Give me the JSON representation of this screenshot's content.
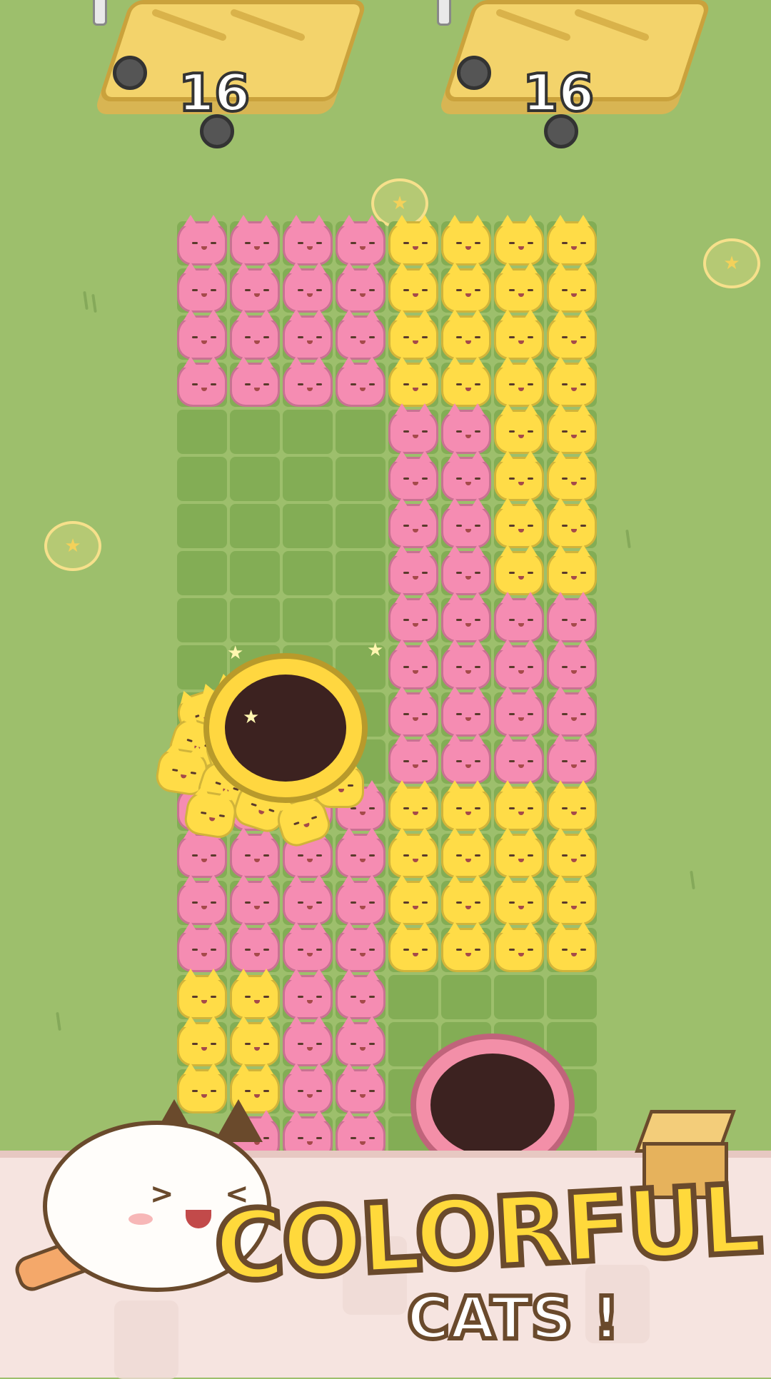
{
  "hud": {
    "cart_left": {
      "count": "16"
    },
    "cart_right": {
      "count": "16"
    }
  },
  "banner": {
    "title": "COLORFUL",
    "subtitle": "CATS !"
  },
  "colors": {
    "grass": "#9dbf6c",
    "pink_cat": "#f58cb2",
    "yellow_cat": "#ffdc47",
    "pink_hole": "#f38fa8",
    "yellow_hole": "#ffd740"
  },
  "icons": {
    "coin": "paw-star-coin-icon",
    "box": "cardboard-box-icon",
    "mascot": "white-cat-mascot"
  }
}
